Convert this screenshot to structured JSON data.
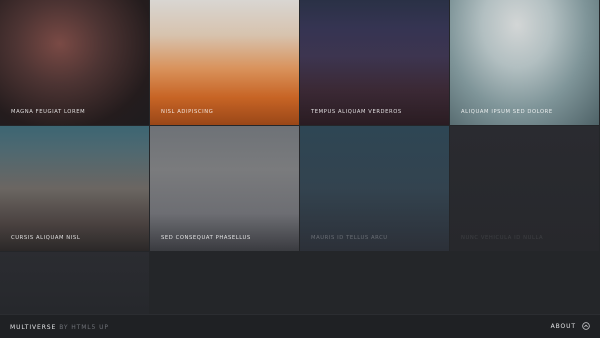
{
  "gallery": {
    "items": [
      {
        "label": "MAGNA FEUGIAT LOREM"
      },
      {
        "label": "NISL ADIPISCING"
      },
      {
        "label": "TEMPUS ALIQUAM VERDEROS"
      },
      {
        "label": "ALIQUAM IPSUM SED DOLORE"
      },
      {
        "label": "CURSIS ALIQUAM NISL"
      },
      {
        "label": "SED CONSEQUAT PHASELLUS"
      },
      {
        "label": "MAURIS ID TELLUS ARCU"
      },
      {
        "label": "NUNC VEHICULA ID NULLA"
      }
    ]
  },
  "footer": {
    "brand": "MULTIVERSE",
    "brand_sub": "BY HTML5 UP",
    "about_label": "ABOUT",
    "about_icon": "chevron-up-circle-icon"
  }
}
